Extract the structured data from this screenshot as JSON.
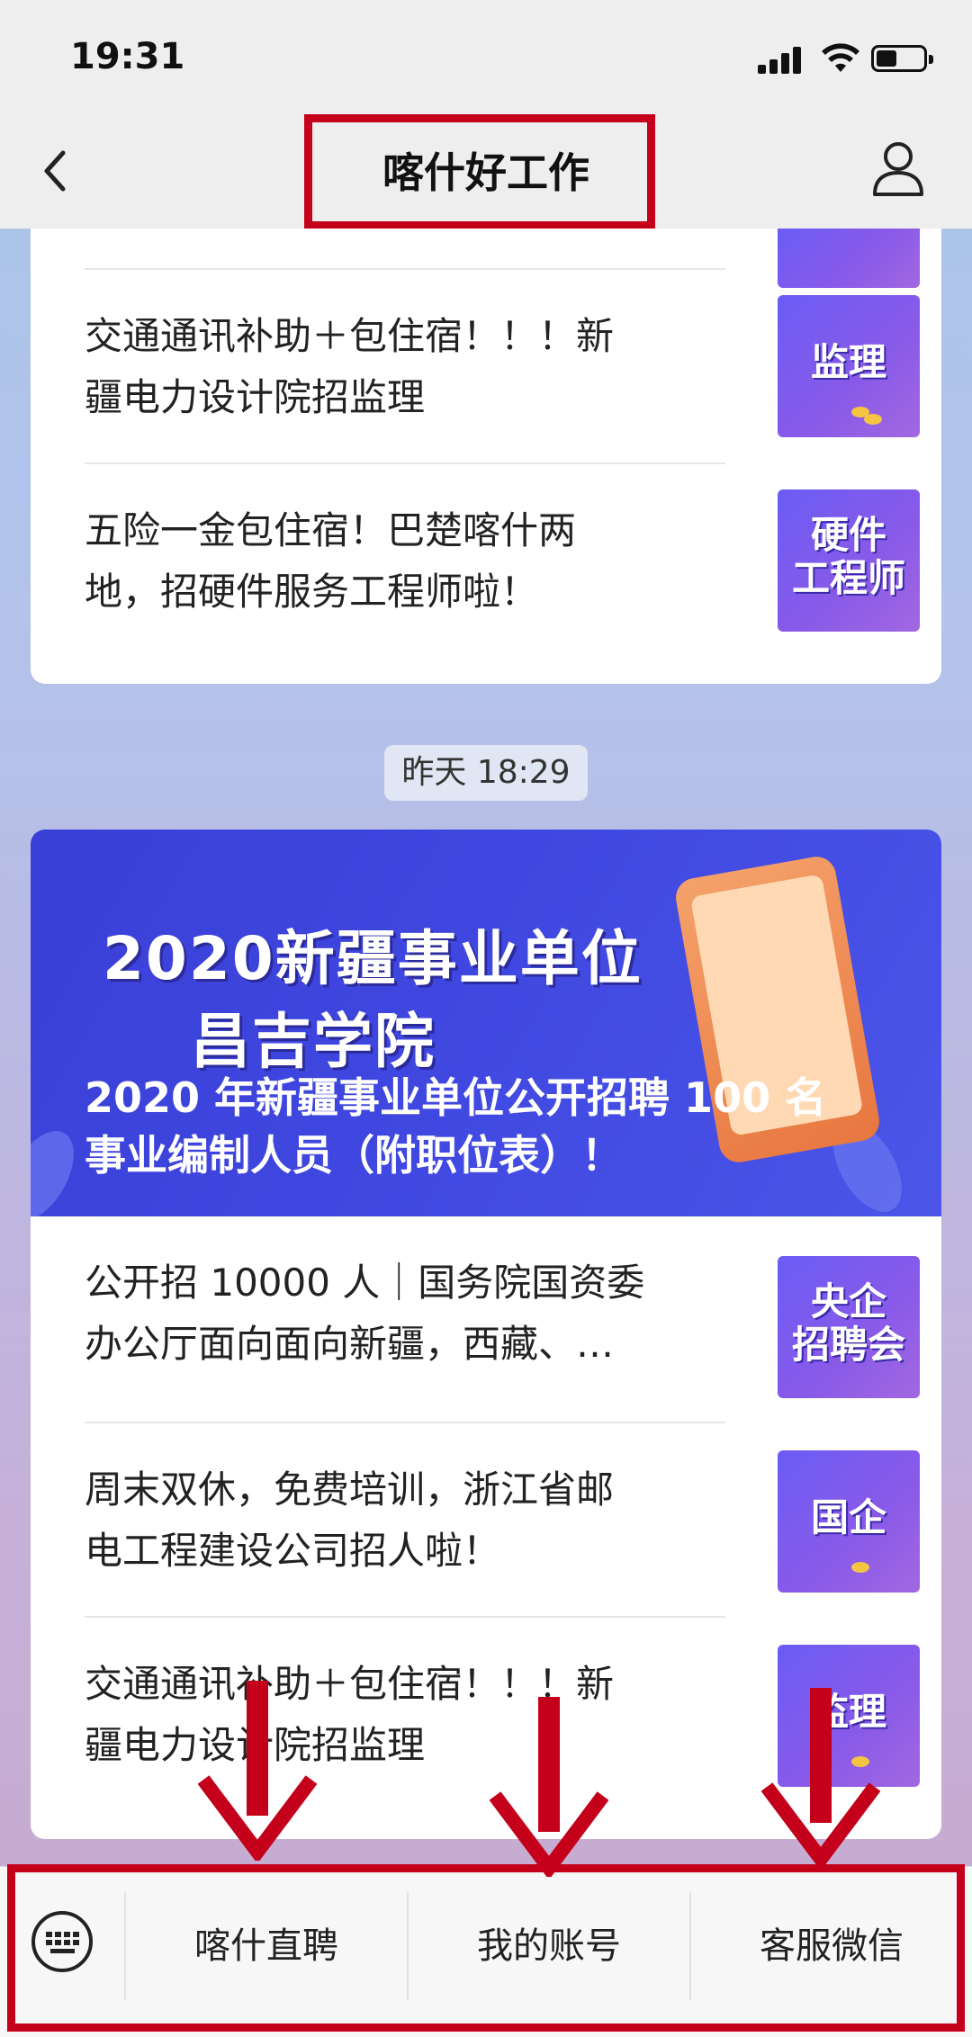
{
  "status_bar": {
    "time": "19:31"
  },
  "nav": {
    "title": "喀什好工作"
  },
  "top_card": {
    "items": [
      {
        "line1": "交通通讯补助＋包住宿！！！新",
        "line2": "疆电力设计院招监理",
        "thumb": [
          "监理"
        ]
      },
      {
        "line1": "五险一金包住宿！巴楚喀什两",
        "line2": "地，招硬件服务工程师啦！",
        "thumb": [
          "硬件",
          "工程师"
        ]
      }
    ]
  },
  "timestamp": "昨天 18:29",
  "bottom_card": {
    "banner": {
      "headline1": "2020新疆事业单位",
      "headline2": "昌吉学院",
      "caption1": "2020 年新疆事业单位公开招聘 100 名",
      "caption2": "事业编制人员（附职位表）！"
    },
    "items": [
      {
        "line1": "公开招 10000 人｜国务院国资委",
        "line2": "办公厅面向面向新疆，西藏、…",
        "thumb": [
          "央企",
          "招聘会"
        ]
      },
      {
        "line1": "周末双休，免费培训，浙江省邮",
        "line2": "电工程建设公司招人啦！",
        "thumb": [
          "国企"
        ]
      },
      {
        "line1": "交通通讯补助＋包住宿！！！新",
        "line2": "疆电力设计院招监理",
        "thumb": [
          "监理"
        ]
      }
    ]
  },
  "menu": {
    "buttons": [
      "喀什直聘",
      "我的账号",
      "客服微信"
    ]
  },
  "colors": {
    "highlight": "#c4001a",
    "accent": "#6b5cf5"
  }
}
